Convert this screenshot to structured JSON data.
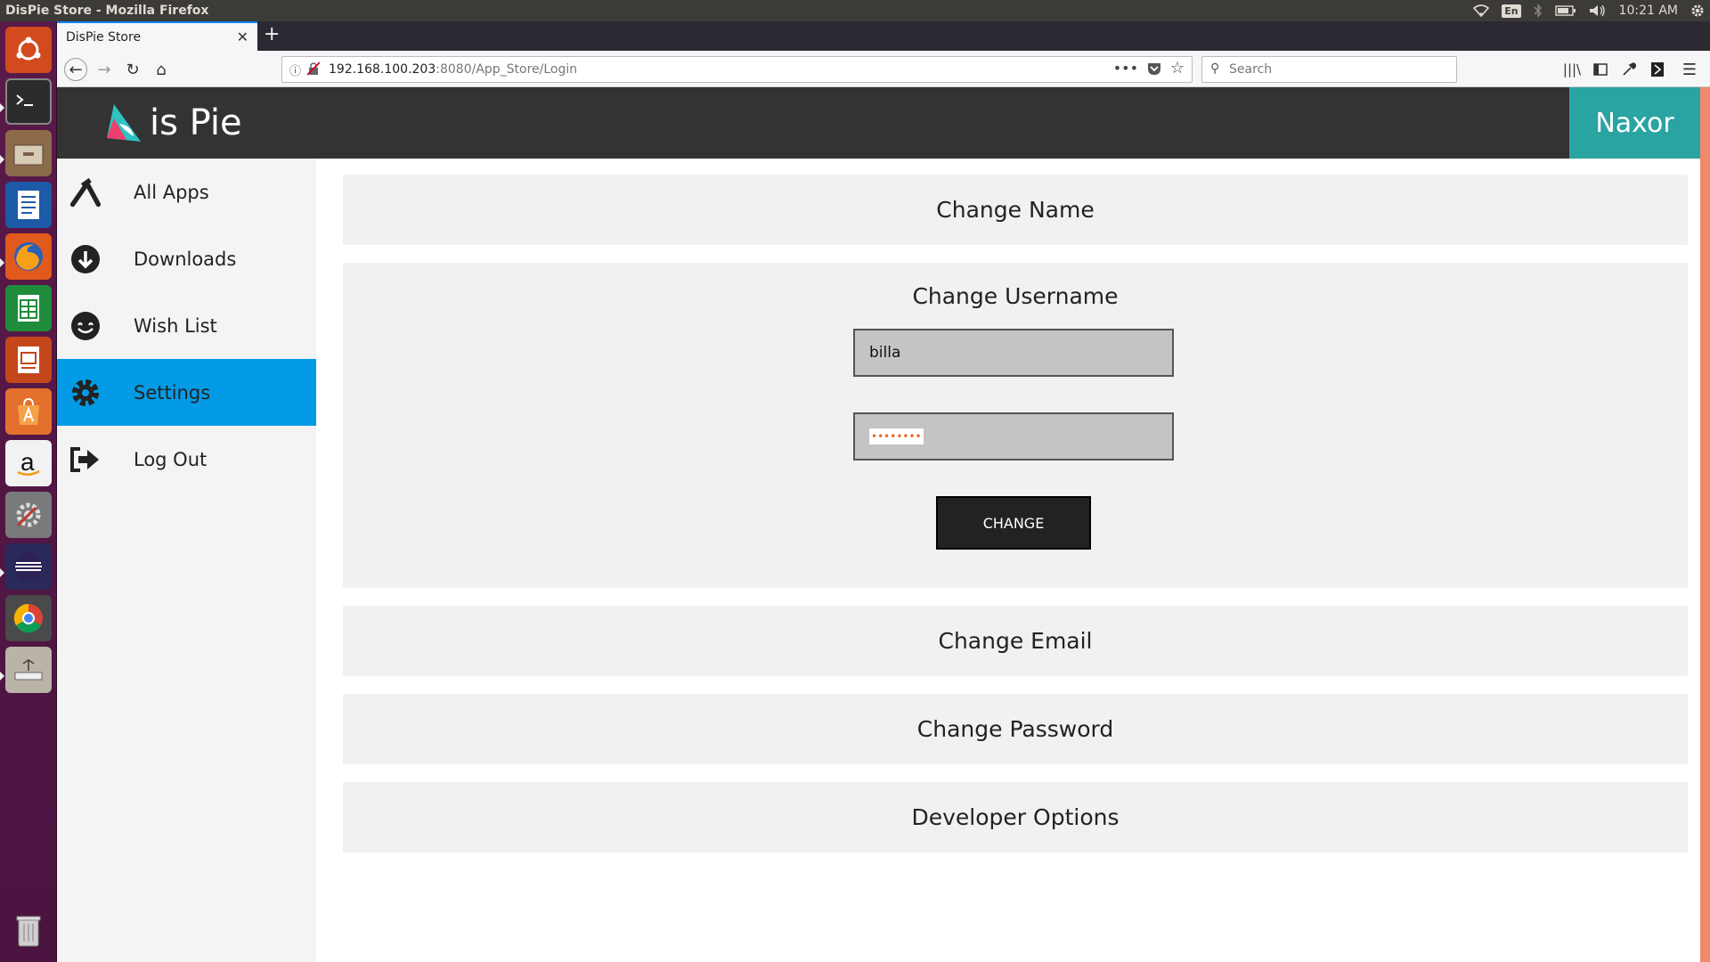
{
  "os": {
    "window_title": "DisPie Store - Mozilla Firefox",
    "lang": "En",
    "time": "10:21 AM"
  },
  "browser": {
    "tab_title": "DisPie Store",
    "url_host": "192.168.100.203",
    "url_rest": ":8080/App_Store/Login",
    "search_placeholder": "Search"
  },
  "app": {
    "logo_text": "is Pie",
    "user_name": "Naxor"
  },
  "sidebar": {
    "items": [
      {
        "label": "All Apps",
        "icon": "all-apps-icon"
      },
      {
        "label": "Downloads",
        "icon": "download-icon"
      },
      {
        "label": "Wish List",
        "icon": "smile-icon"
      },
      {
        "label": "Settings",
        "icon": "gear-icon",
        "active": true
      },
      {
        "label": "Log Out",
        "icon": "logout-icon"
      }
    ]
  },
  "settings": {
    "change_name": "Change Name",
    "change_username": "Change Username",
    "username_value": "billa",
    "password_value": "••••••••",
    "change_button": "CHANGE",
    "change_email": "Change Email",
    "change_password": "Change Password",
    "developer_options": "Developer Options"
  },
  "colors": {
    "header_bg": "#333333",
    "user_box_bg": "#2aa3a3",
    "active_item_bg": "#039be5",
    "panel_bg": "#f1f1f1"
  }
}
